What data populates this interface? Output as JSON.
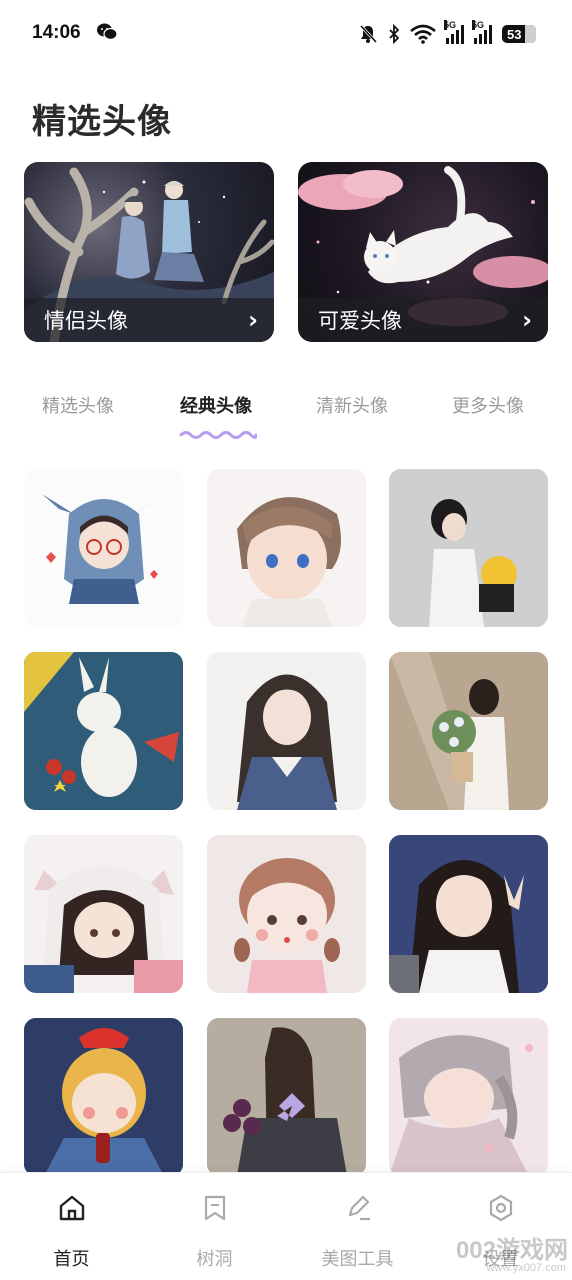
{
  "status_bar": {
    "time": "14:06",
    "network_1": "5G",
    "network_2": "5G",
    "battery": "53"
  },
  "page": {
    "title": "精选头像"
  },
  "banners": [
    {
      "label": "情侣头像",
      "arrow": "›"
    },
    {
      "label": "可爱头像",
      "arrow": "›"
    }
  ],
  "tabs": [
    {
      "label": "精选头像",
      "active": false
    },
    {
      "label": "经典头像",
      "active": true
    },
    {
      "label": "清新头像",
      "active": false
    },
    {
      "label": "更多头像",
      "active": false
    }
  ],
  "colors": {
    "accent": "#b59df0",
    "text": "#222222",
    "inactive": "#9a9a9a"
  },
  "bottom_nav": [
    {
      "label": "首页",
      "icon": "home-icon",
      "active": true
    },
    {
      "label": "树洞",
      "icon": "bookmark-icon",
      "active": false
    },
    {
      "label": "美图工具",
      "icon": "pen-icon",
      "active": false
    },
    {
      "label": "设置",
      "icon": "settings-icon",
      "active": false
    }
  ],
  "watermark": {
    "main": "002游戏网",
    "sub": "www.yx007.com"
  }
}
